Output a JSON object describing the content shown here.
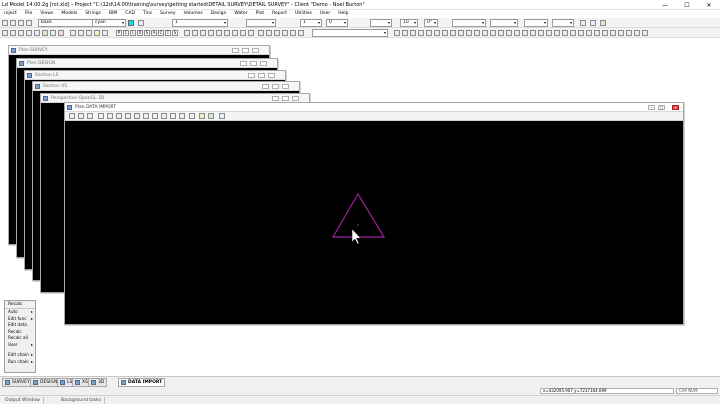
{
  "window": {
    "title": "Ld Model 14.00.2g [rst.xld] - Project \"C:\\12d\\14.00\\training\\survey\\getting started\\DETAIL SURVEY\\DETAIL SURVEY\" - Client \"Demo - Noel Burton\"",
    "minimize": "—",
    "maximize": "☐",
    "close": "✕"
  },
  "menu": [
    "roject",
    "File",
    "Views",
    "Models",
    "Strings",
    "BIM",
    "CAD",
    "Tins",
    "Survey",
    "Volumes",
    "Design",
    "Water",
    "Plot",
    "Report",
    "Utilities",
    "User",
    "Help"
  ],
  "toolbar": {
    "layer_value": "base",
    "colour_value": "cyan",
    "colour_swatch": "#00e5ff",
    "weight_value": "1",
    "field_a": "1",
    "field_b": "0",
    "field_c": "10",
    "angle_value": "0°",
    "letters": [
      "P",
      "C",
      "L",
      "X",
      "S",
      "A",
      "C",
      "T",
      "S"
    ]
  },
  "windows": [
    {
      "title": "Plan SURVEY"
    },
    {
      "title": "Plan DESIGN"
    },
    {
      "title": "Section LS"
    },
    {
      "title": "Section XS"
    },
    {
      "title": "Perspective OpenGL 3D"
    }
  ],
  "active_window": {
    "title": "Plan DATA IMPORT",
    "canvas_background": "#000000",
    "triangle_color": "#a020a0"
  },
  "side_menu": {
    "title": "Recalc",
    "items": [
      {
        "label": "Auto",
        "sub": true
      },
      {
        "label": "Edit func",
        "sub": true
      },
      {
        "label": "Edit data",
        "sub": false
      },
      {
        "label": "Recalc",
        "sub": false
      },
      {
        "label": "Recalc all",
        "sub": false
      },
      {
        "label": "User",
        "sub": true
      }
    ],
    "items2": [
      {
        "label": "Edit chain",
        "sub": true
      },
      {
        "label": "Run chain",
        "sub": true
      }
    ]
  },
  "tabs": [
    "SURVEY",
    "DESIGN",
    "LS",
    "XS",
    "3D",
    "DATA IMPORT"
  ],
  "active_tab": "DATA IMPORT",
  "status": {
    "coordinates": "x=432095.907 y=7237164.699",
    "caps": "CAP NUM"
  },
  "bottom_tabs": [
    "Output Window",
    "Background tasks"
  ]
}
